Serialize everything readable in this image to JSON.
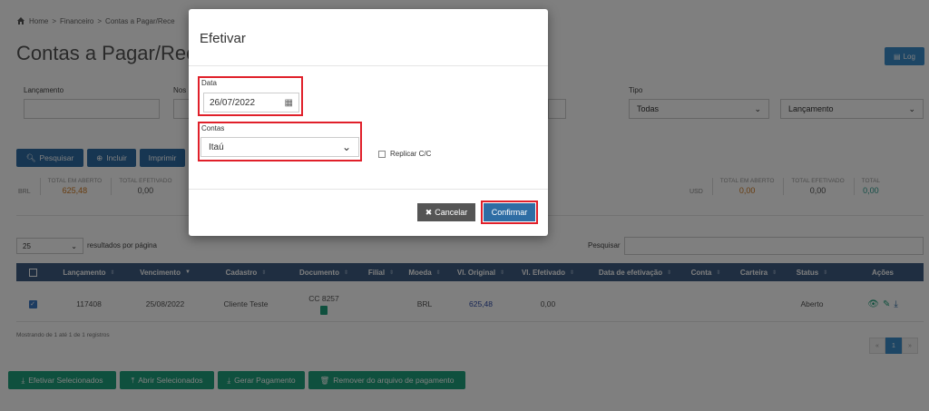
{
  "breadcrumb": {
    "home": "Home",
    "sep": ">",
    "level1": "Financeiro",
    "level2": "Contas a Pagar/Rece"
  },
  "page": {
    "title": "Contas a Pagar/Receb",
    "log_label": "Log"
  },
  "filters": {
    "lancamento_label": "Lançamento",
    "nos_label": "Nos",
    "tipo_label": "Tipo",
    "tipo_value": "Todas",
    "order_value": "Lançamento"
  },
  "toolbar": {
    "search": "Pesquisar",
    "include": "Incluir",
    "print": "Imprimir"
  },
  "totals_left": {
    "currency": "BRL",
    "open_label": "TOTAL EM ABERTO",
    "open_value": "625,48",
    "done_label": "TOTAL EFETIVADO",
    "done_value": "0,00"
  },
  "totals_right": {
    "currency": "USD",
    "open_label": "TOTAL EM ABERTO",
    "open_value": "0,00",
    "done_label": "TOTAL EFETIVADO",
    "done_value": "0,00",
    "total_label": "TOTAL",
    "total_value": "0,00"
  },
  "table_controls": {
    "per_page": "25",
    "per_page_label": "resultados por página",
    "search_label": "Pesquisar"
  },
  "table": {
    "headers": [
      "Lançamento",
      "Vencimento",
      "Cadastro",
      "Documento",
      "Filial",
      "Moeda",
      "Vl. Original",
      "Vl. Efetivado",
      "Data de efetivação",
      "Conta",
      "Carteira",
      "Status",
      "Ações"
    ],
    "row": {
      "lancamento": "117408",
      "vencimento": "25/08/2022",
      "cadastro": "Cliente Teste",
      "documento": "CC 8257",
      "filial": "",
      "moeda": "BRL",
      "vl_original": "625,48",
      "vl_efetivado": "0,00",
      "data_efetivacao": "",
      "conta": "",
      "carteira": "",
      "status": "Aberto"
    }
  },
  "footer": {
    "showing": "Mostrando de 1 até 1 de 1 registros",
    "pager_prev": "«",
    "pager_page": "1",
    "pager_next": "»",
    "btn_efetivar": "Efetivar Selecionados",
    "btn_abrir": "Abrir Selecionados",
    "btn_gerar": "Gerar Pagamento",
    "btn_remover": "Remover do arquivo de pagamento"
  },
  "modal": {
    "title": "Efetivar",
    "date_label": "Data",
    "date_value": "26/07/2022",
    "accounts_label": "Contas",
    "accounts_value": "Itaú",
    "replicate_label": "Replicar C/C",
    "cancel_label": "Cancelar",
    "confirm_label": "Confirmar"
  },
  "colors": {
    "highlight": "#e0202a",
    "primary": "#2e6da4",
    "table_header": "#3f5d82",
    "green": "#1fa17c"
  }
}
